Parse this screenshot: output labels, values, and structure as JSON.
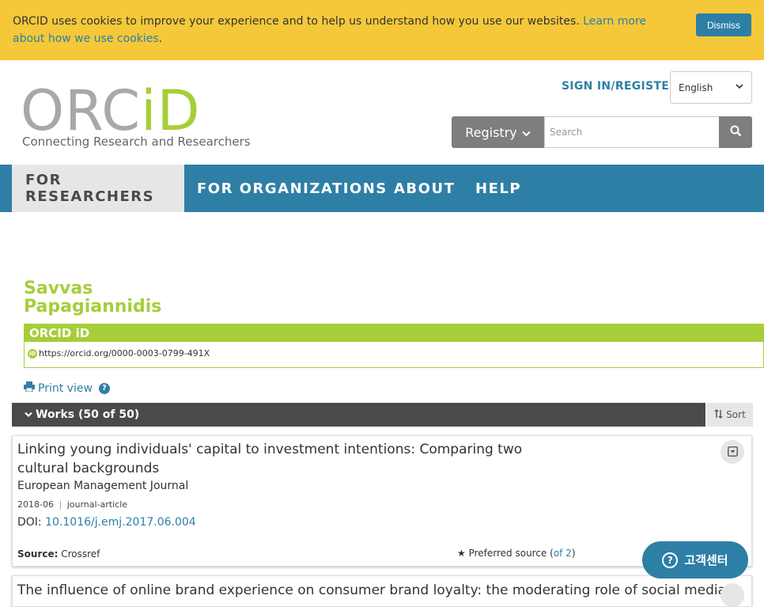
{
  "cookie": {
    "text": "ORCID uses cookies to improve your experience and to help us understand how you use our websites. ",
    "link": "Learn more about how we use cookies",
    "suffix": ".",
    "dismiss_label": "Dismiss"
  },
  "header": {
    "logo_main": "ORC",
    "logo_id": "iD",
    "tagline": "Connecting Research and Researchers",
    "signin_label": "SIGN IN/REGISTER",
    "language": "English",
    "registry_label": "Registry",
    "search_placeholder": "Search"
  },
  "nav": {
    "items": [
      {
        "label": "FOR RESEARCHERS"
      },
      {
        "label": "FOR ORGANIZATIONS"
      },
      {
        "label": "ABOUT"
      },
      {
        "label": "HELP"
      }
    ]
  },
  "profile": {
    "first_name": "Savvas",
    "last_name": "Papagiannidis",
    "orcid_heading": "ORCID iD",
    "orcid_url": "https://orcid.org/0000-0003-0799-491X",
    "print_view_label": "Print view"
  },
  "works": {
    "header_label": "Works (50 of 50)",
    "sort_label": "Sort",
    "items": [
      {
        "title": "Linking young individuals' capital to investment intentions: Comparing two cultural backgrounds",
        "journal": "European Management Journal",
        "date": "2018-06",
        "type": "journal-article",
        "doi_label": "DOI: ",
        "doi": "10.1016/j.emj.2017.06.004",
        "source_label": "Source:",
        "source": "Crossref",
        "preferred_label": "Preferred source (",
        "preferred_link": "of 2",
        "preferred_suffix": ")"
      },
      {
        "title": "The influence of online brand experience on consumer brand loyalty: the moderating role of social media"
      }
    ]
  },
  "help_center": {
    "label": "고객센터"
  },
  "colors": {
    "brand_green": "#a6ce39",
    "brand_blue": "#2e7fa6",
    "cookie_yellow": "#f5c83a",
    "works_bar": "#494a4c"
  }
}
